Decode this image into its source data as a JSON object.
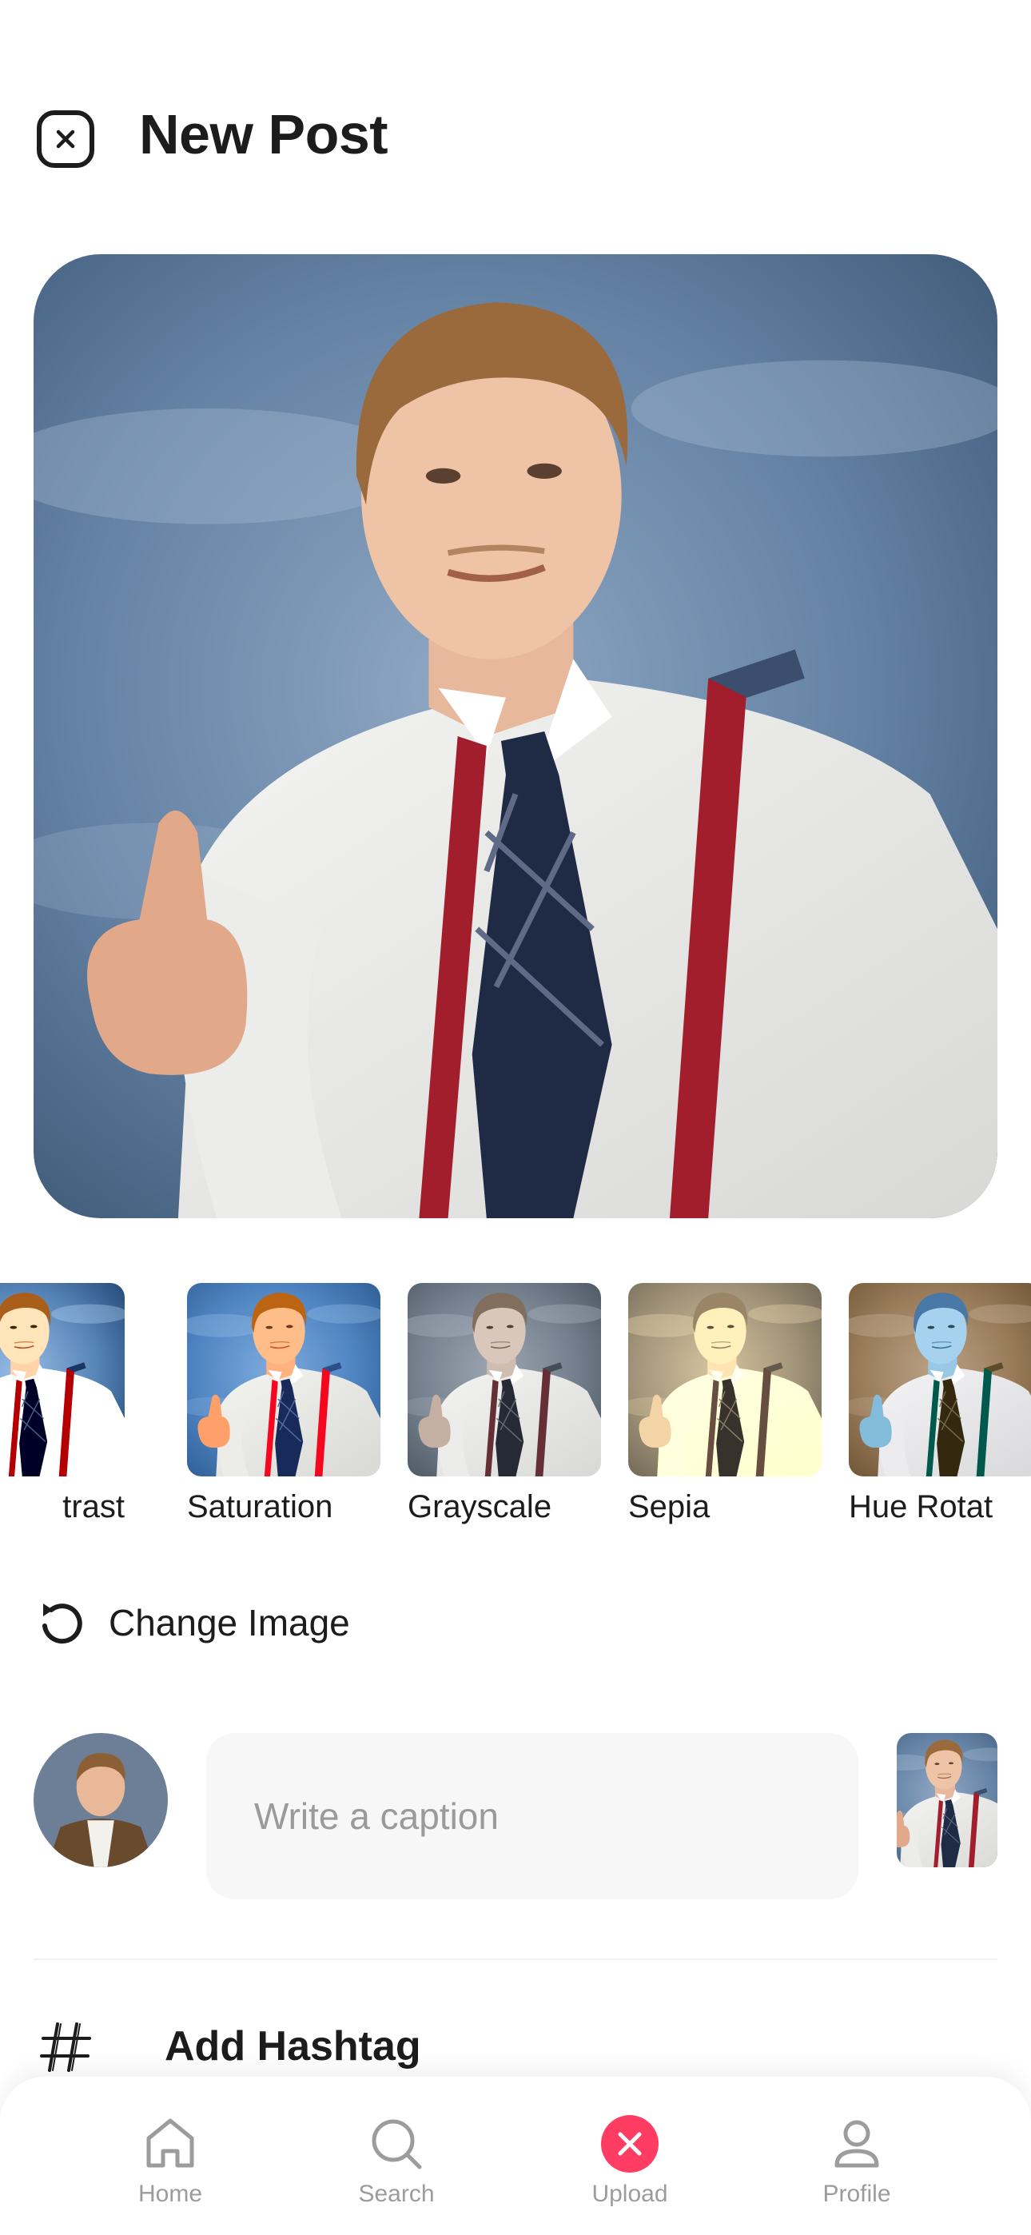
{
  "header": {
    "title": "New Post",
    "close_icon": "close-icon"
  },
  "filters": [
    {
      "label": "trast",
      "tone": "contrast"
    },
    {
      "label": "Saturation",
      "tone": "saturation"
    },
    {
      "label": "Grayscale",
      "tone": "grayscale"
    },
    {
      "label": "Sepia",
      "tone": "sepia"
    },
    {
      "label": "Hue Rotat",
      "tone": "hue"
    }
  ],
  "actions": {
    "change_image_label": "Change Image",
    "change_image_icon": "rotate-ccw-icon"
  },
  "caption": {
    "placeholder": "Write a caption"
  },
  "hashtag": {
    "label": "Add Hashtag",
    "icon": "hash-icon"
  },
  "nav": {
    "items": [
      {
        "label": "Home",
        "icon": "home-icon"
      },
      {
        "label": "Search",
        "icon": "search-icon"
      },
      {
        "label": "Upload",
        "icon": "upload-close-icon"
      },
      {
        "label": "Profile",
        "icon": "profile-icon"
      }
    ]
  },
  "colors": {
    "accent": "#ff3d63",
    "text": "#1c1c1c",
    "muted": "#9c9c9c",
    "suspenders": "#a31e2c",
    "backdrop": "#5f7a9a"
  }
}
